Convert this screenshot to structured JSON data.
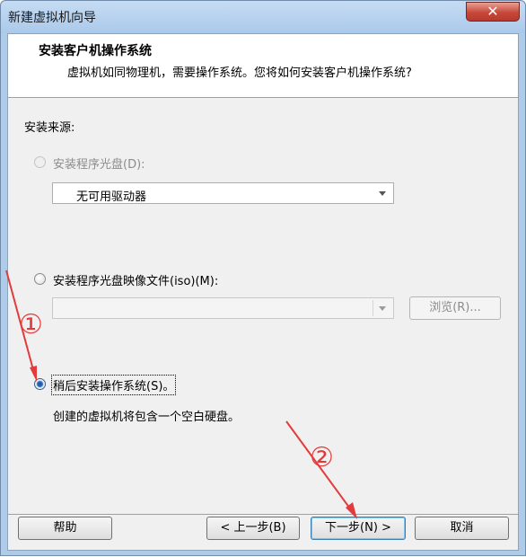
{
  "window": {
    "title": "新建虚拟机向导",
    "close_icon": "✕"
  },
  "header": {
    "title": "安装客户机操作系统",
    "subtitle": "虚拟机如同物理机，需要操作系统。您将如何安装客户机操作系统?"
  },
  "source": {
    "label": "安装来源:",
    "option_disc": {
      "label": "安装程序光盘(D):",
      "selected": false,
      "enabled": false
    },
    "disc_combo_value": "无可用驱动器",
    "option_iso": {
      "label": "安装程序光盘映像文件(iso)(M):",
      "selected": false,
      "enabled": true
    },
    "iso_combo_value": "",
    "browse_label": "浏览(R)...",
    "option_later": {
      "label": "稍后安装操作系统(S)。",
      "selected": true,
      "enabled": true
    },
    "later_note": "创建的虚拟机将包含一个空白硬盘。"
  },
  "footer": {
    "help_label": "帮助",
    "back_label": "< 上一步(B)",
    "next_label": "下一步(N) >",
    "cancel_label": "取消"
  },
  "annotations": {
    "marker_1": "①",
    "marker_2": "②",
    "color": "#e23b3b"
  }
}
